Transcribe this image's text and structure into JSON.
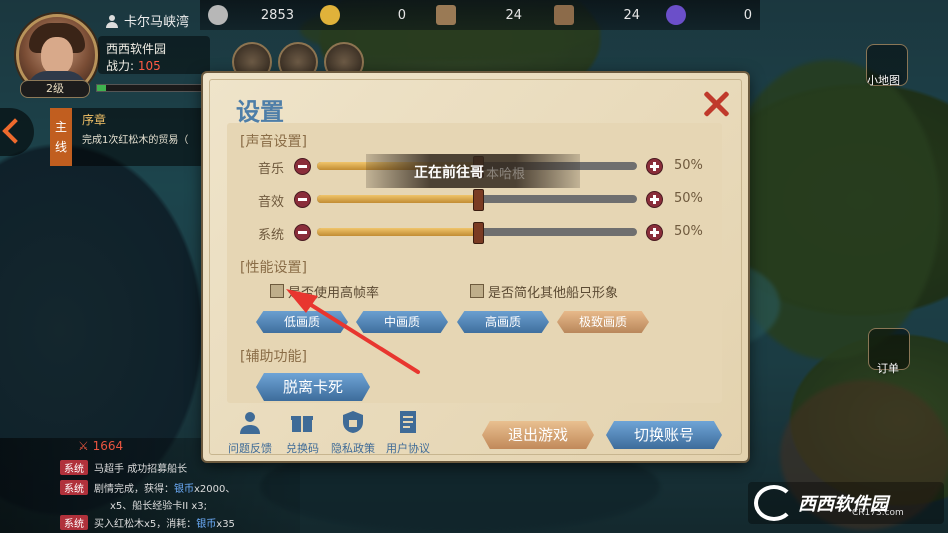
{
  "hud": {
    "location": "卡尔马峡湾",
    "resources": [
      {
        "icon": "silver-coin-icon",
        "value": "2853",
        "color": "#b7b7b7"
      },
      {
        "icon": "gold-coin-icon",
        "value": "0",
        "color": "#e0b23a"
      },
      {
        "icon": "scroll-icon",
        "value": "24",
        "color": "#9a7a55"
      },
      {
        "icon": "card-icon",
        "value": "24",
        "color": "#8c6b4a"
      },
      {
        "icon": "gem-icon",
        "value": "0",
        "color": "#6b4fc9"
      }
    ],
    "player_name": "西西软件园",
    "power_label": "战力:",
    "power_value": "105",
    "level": "2级",
    "exp_fraction": 0.08
  },
  "quest": {
    "tag": [
      "主",
      "线"
    ],
    "title": "序章",
    "desc": "完成1次红松木的贸易（"
  },
  "side": {
    "minimap_label": "小地图",
    "orders_label": "订单"
  },
  "chat": {
    "hp": "1664",
    "lines": [
      {
        "tag": "系统",
        "text": "马超手 ",
        "hl": "",
        "rest": "成功招募船长"
      },
      {
        "tag": "系统",
        "text": "剧情完成，获得：",
        "hl": "银币",
        "rest": "x2000、"
      },
      {
        "tag": "",
        "text": "x5、船长经验卡II x3;",
        "hl": "",
        "rest": ""
      },
      {
        "tag": "系统",
        "text": "买入红松木x5，消耗：",
        "hl": "银币",
        "rest": "x35"
      }
    ]
  },
  "watermark": {
    "brand": "西西软件园",
    "url": "CR173.com"
  },
  "settings": {
    "title": "设置",
    "sound_section": "[声音设置]",
    "perf_section": "[性能设置]",
    "assist_section": "[辅助功能]",
    "sliders": [
      {
        "label": "音乐",
        "value": 50,
        "pct": "50%"
      },
      {
        "label": "音效",
        "value": 50,
        "pct": "50%"
      },
      {
        "label": "系统",
        "value": 50,
        "pct": "50%"
      }
    ],
    "checkbox_high_fps": "是否使用高帧率",
    "checkbox_simplify_ships": "是否简化其他船只形象",
    "quality": [
      {
        "label": "低画质",
        "active": false
      },
      {
        "label": "中画质",
        "active": false
      },
      {
        "label": "高画质",
        "active": false
      },
      {
        "label": "极致画质",
        "active": true
      }
    ],
    "unstuck": "脱离卡死",
    "bottom_links": [
      {
        "label": "问题反馈",
        "icon": "user-feedback-icon"
      },
      {
        "label": "兑换码",
        "icon": "gift-icon"
      },
      {
        "label": "隐私政策",
        "icon": "lock-shield-icon"
      },
      {
        "label": "用户协议",
        "icon": "document-icon"
      }
    ],
    "exit_game": "退出游戏",
    "switch_account": "切换账号"
  },
  "toast": {
    "text": "正在前往哥",
    "ghost": "本哈根"
  }
}
